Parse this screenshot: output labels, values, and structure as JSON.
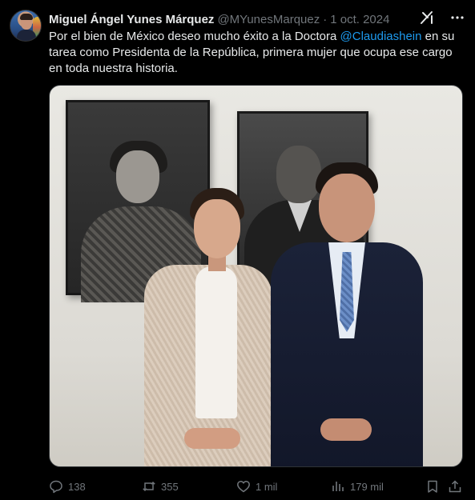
{
  "tweet": {
    "author": {
      "display_name": "Miguel Ángel Yunes Márquez",
      "handle": "@MYunesMarquez",
      "separator": "·",
      "date": "1 oct. 2024"
    },
    "text_parts": {
      "before_mention": "Por el bien de México deseo mucho éxito a la Doctora ",
      "mention": "@Claudiashein",
      "after_mention": " en su tarea como Presidenta de la República, primera mujer que ocupa ese cargo en toda nuestra historia."
    },
    "icons": {
      "grok": "grok-icon",
      "more": "more-icon"
    },
    "actions": {
      "replies": "138",
      "retweets": "355",
      "likes": "1 mil",
      "views": "179 mil"
    },
    "colors": {
      "background": "#000000",
      "text": "#e7e9ea",
      "muted": "#71767b",
      "link": "#1d9bf0"
    }
  }
}
